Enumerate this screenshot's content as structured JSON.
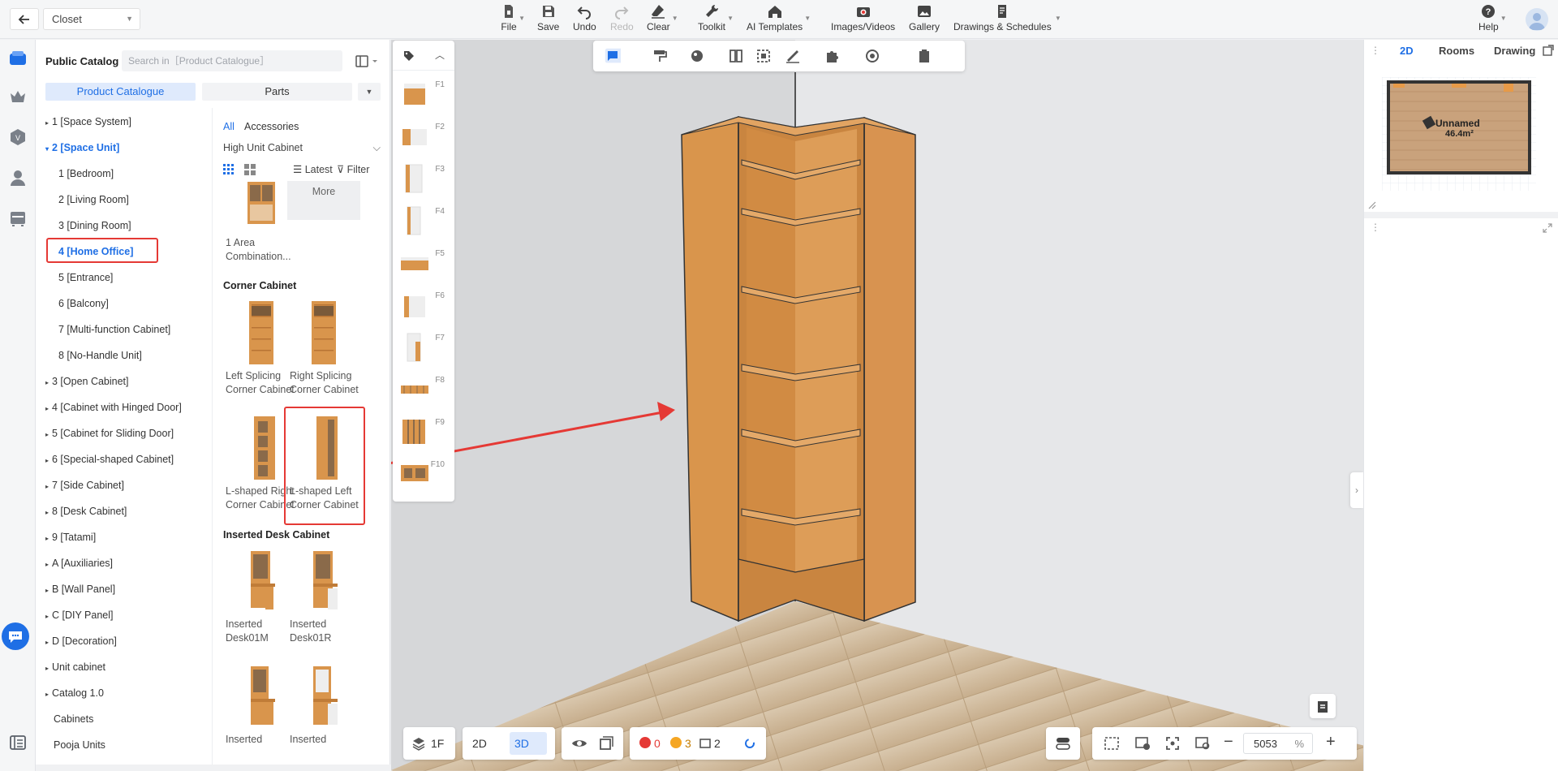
{
  "header": {
    "project_name": "Closet",
    "tools": [
      {
        "label": "File",
        "icon": "file-icon"
      },
      {
        "label": "Save",
        "icon": "save-icon"
      },
      {
        "label": "Undo",
        "icon": "undo-icon"
      },
      {
        "label": "Redo",
        "icon": "redo-icon"
      },
      {
        "label": "Clear",
        "icon": "eraser-icon"
      },
      {
        "label": "Toolkit",
        "icon": "wrench-icon"
      },
      {
        "label": "AI Templates",
        "icon": "ai-house-icon"
      },
      {
        "label": "Images/Videos",
        "icon": "camera-icon"
      },
      {
        "label": "Gallery",
        "icon": "gallery-icon"
      },
      {
        "label": "Drawings & Schedules",
        "icon": "drawings-icon"
      },
      {
        "label": "Help",
        "icon": "help-icon"
      }
    ]
  },
  "catalog": {
    "title": "Public Catalog",
    "search_placeholder": "Search in［Product Catalogue］",
    "tabs": [
      "Product Catalogue",
      "Parts"
    ],
    "tree": [
      {
        "label": "1 [Space System]",
        "level": 0,
        "state": "collapsed"
      },
      {
        "label": "2 [Space Unit]",
        "level": 0,
        "state": "open"
      },
      {
        "label": "1 [Bedroom]",
        "level": 1
      },
      {
        "label": "2 [Living Room]",
        "level": 1
      },
      {
        "label": "3 [Dining Room]",
        "level": 1
      },
      {
        "label": "4 [Home Office]",
        "level": 1,
        "state": "selected"
      },
      {
        "label": "5 [Entrance]",
        "level": 1
      },
      {
        "label": "6 [Balcony]",
        "level": 1
      },
      {
        "label": "7 [Multi-function Cabinet]",
        "level": 1
      },
      {
        "label": "8 [No-Handle Unit]",
        "level": 1
      },
      {
        "label": "3 [Open Cabinet]",
        "level": 0,
        "state": "collapsed"
      },
      {
        "label": "4 [Cabinet with Hinged Door]",
        "level": 0,
        "state": "collapsed"
      },
      {
        "label": "5 [Cabinet for Sliding Door]",
        "level": 0,
        "state": "collapsed"
      },
      {
        "label": "6 [Special-shaped Cabinet]",
        "level": 0,
        "state": "collapsed"
      },
      {
        "label": "7 [Side Cabinet]",
        "level": 0,
        "state": "collapsed"
      },
      {
        "label": "8 [Desk Cabinet]",
        "level": 0,
        "state": "collapsed"
      },
      {
        "label": "9 [Tatami]",
        "level": 0,
        "state": "collapsed"
      },
      {
        "label": "A [Auxiliaries]",
        "level": 0,
        "state": "collapsed"
      },
      {
        "label": "B [Wall Panel]",
        "level": 0,
        "state": "collapsed"
      },
      {
        "label": "C [DIY Panel]",
        "level": 0,
        "state": "collapsed"
      },
      {
        "label": "D [Decoration]",
        "level": 0,
        "state": "collapsed"
      },
      {
        "label": "Unit cabinet",
        "level": 0,
        "state": "collapsed"
      },
      {
        "label": "Catalog 1.0",
        "level": 0,
        "state": "collapsed"
      },
      {
        "label": "Cabinets",
        "level": 0
      },
      {
        "label": "Pooja Units",
        "level": 0
      }
    ],
    "filter_tabs": [
      "All",
      "Accessories"
    ],
    "category_select": "High Unit Cabinet",
    "sort_label": "Latest",
    "filter_label": "Filter",
    "more_label": "More",
    "top_product": "1 Area Combination...",
    "sections": [
      {
        "title": "Corner Cabinet",
        "products": [
          "Left Splicing Corner Cabinet",
          "Right Splicing Corner Cabinet",
          "L-shaped Right Corner Cabinet",
          "L-shaped Left Corner Cabinet"
        ]
      },
      {
        "title": "Inserted Desk Cabinet",
        "products": [
          "Inserted Desk01M",
          "Inserted Desk01R",
          "Inserted",
          "Inserted"
        ]
      }
    ]
  },
  "favorites": [
    "F1",
    "F2",
    "F3",
    "F4",
    "F5",
    "F6",
    "F7",
    "F8",
    "F9",
    "F10"
  ],
  "viewport_bottom": {
    "floor": "1F",
    "mode_2d": "2D",
    "mode_3d": "3D",
    "errors": "0",
    "warnings": "3",
    "views": "2",
    "zoom_value": "5053",
    "zoom_unit": "%"
  },
  "right_panel": {
    "tabs": [
      "2D",
      "Rooms",
      "Drawing"
    ],
    "active_tab": "2D",
    "room_name": "Unnamed",
    "room_area": "46.4m²"
  },
  "colors": {
    "accent": "#1f6fe5",
    "highlight_box": "#e53935",
    "wood": "#d9954c"
  }
}
